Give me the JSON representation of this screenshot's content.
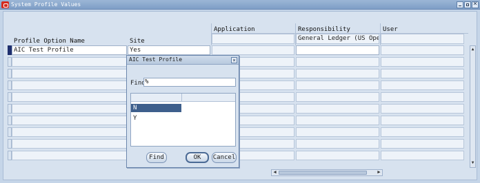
{
  "window": {
    "title": "System Profile Values"
  },
  "columns": {
    "profile_option_name": "Profile Option Name",
    "site": "Site",
    "application": "Application",
    "responsibility": "Responsibility",
    "user": "User"
  },
  "header_values": {
    "responsibility": "General Ledger (US Opera"
  },
  "rows": [
    {
      "profile_option": "AIC Test Profile",
      "site": "Yes"
    }
  ],
  "dialog": {
    "title": "AIC Test Profile",
    "find_label": "Find",
    "find_value": "%",
    "options": [
      "N",
      "Y"
    ],
    "selected_option": "N",
    "buttons": {
      "find": "Find",
      "ok": "OK",
      "cancel": "Cancel"
    }
  }
}
